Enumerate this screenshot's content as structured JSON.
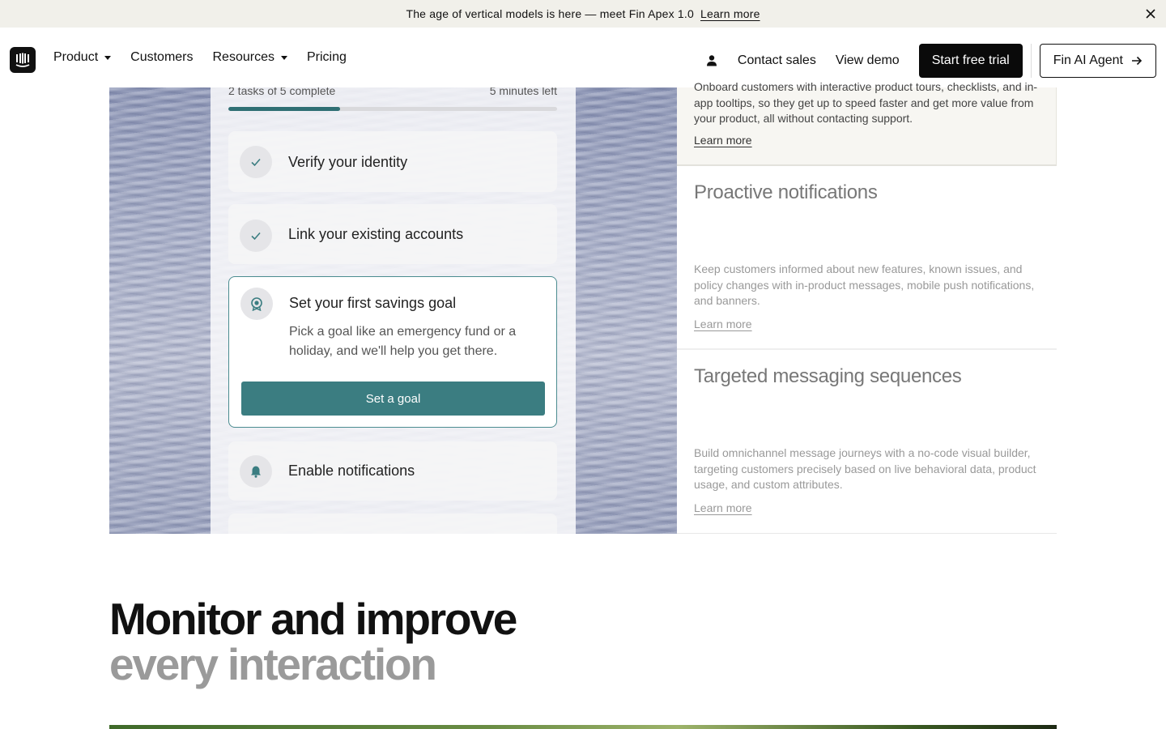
{
  "announcement": {
    "message": "The age of vertical models is here — meet Fin Apex 1.0",
    "link": "Learn more"
  },
  "nav": {
    "items": [
      {
        "label": "Product",
        "has_dropdown": true
      },
      {
        "label": "Customers",
        "has_dropdown": false
      },
      {
        "label": "Resources",
        "has_dropdown": true
      },
      {
        "label": "Pricing",
        "has_dropdown": false
      }
    ],
    "contact_sales": "Contact sales",
    "view_demo": "View demo",
    "start_trial": "Start free trial",
    "fin_agent": "Fin AI Agent"
  },
  "checklist": {
    "progress_label": "2 tasks of 5 complete",
    "time_left": "5 minutes left",
    "progress_fraction": 0.34,
    "tasks": [
      {
        "title": "Verify your identity",
        "status": "complete",
        "icon": "check-icon"
      },
      {
        "title": "Link your existing accounts",
        "status": "complete",
        "icon": "check-icon"
      },
      {
        "title": "Set your first savings goal",
        "status": "active",
        "icon": "target-icon",
        "description": "Pick a goal like an emergency fund or a holiday, and we'll help you get there.",
        "button": "Set a goal"
      },
      {
        "title": "Enable notifications",
        "status": "pending",
        "icon": "bell-icon"
      }
    ]
  },
  "features": [
    {
      "title": "",
      "description": "Onboard customers with interactive product tours, checklists, and in-app tooltips, so they get up to speed faster and get more value from your product, all without contacting support.",
      "link": "Learn more"
    },
    {
      "title": "Proactive notifications",
      "description": "Keep customers informed about new features, known issues, and policy changes with in-product messages, mobile push notifications, and banners.",
      "link": "Learn more"
    },
    {
      "title": "Targeted messaging sequences",
      "description": "Build omnichannel message journeys with a no-code visual builder, targeting customers precisely based on live behavioral data, product usage, and custom attributes.",
      "link": "Learn more"
    }
  ],
  "section": {
    "heading_line1": "Monitor and improve",
    "heading_line2": "every interaction"
  },
  "colors": {
    "accent_teal": "#3b7d81",
    "announcement_bg": "#f1f0ea",
    "button_dark": "#0a0a0a"
  }
}
